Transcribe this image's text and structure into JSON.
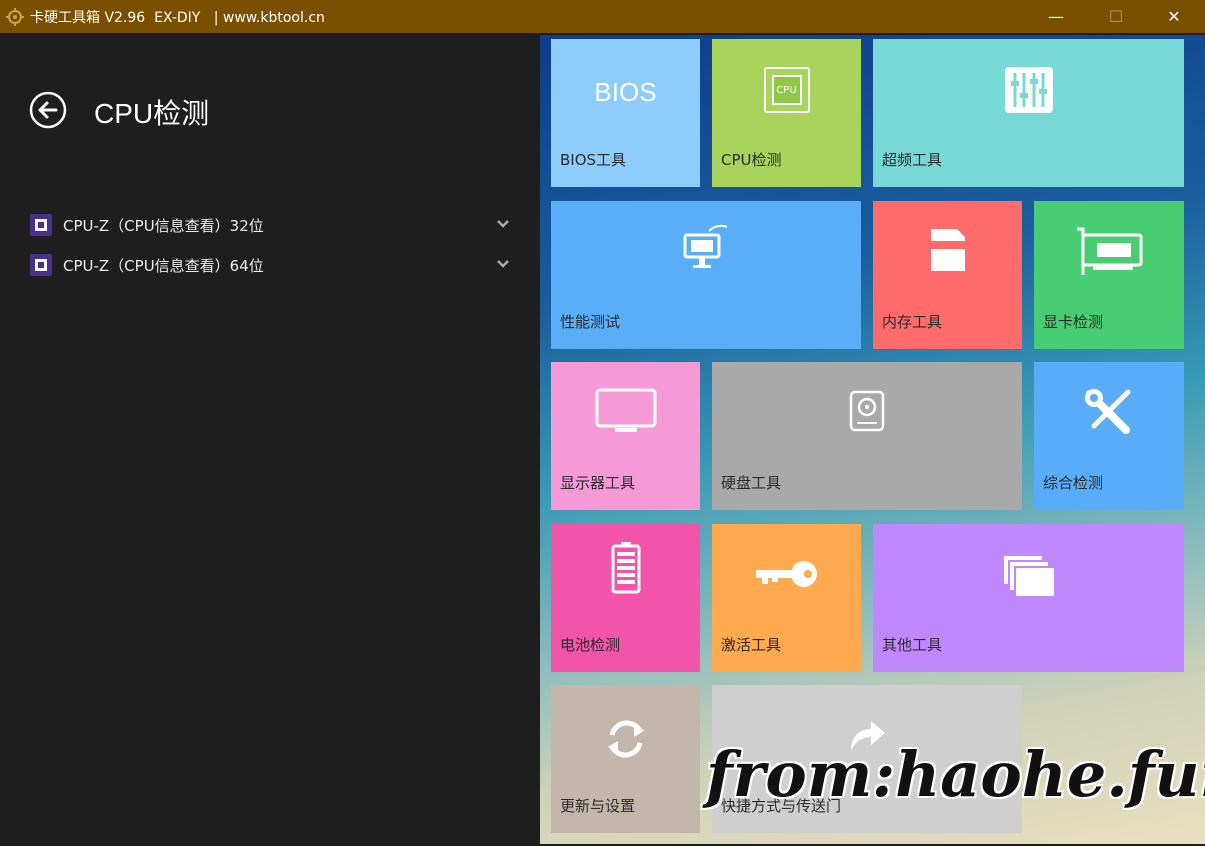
{
  "window": {
    "title": "卡硬工具箱 V2.96  EX-DIY   | www.kbtool.cn",
    "min_glyph": "—",
    "max_glyph": "☐",
    "close_glyph": "✕"
  },
  "page": {
    "title": "CPU检测",
    "items": [
      {
        "label": "CPU-Z（CPU信息查看）32位"
      },
      {
        "label": "CPU-Z（CPU信息查看）64位"
      }
    ]
  },
  "tiles": [
    {
      "id": "bios",
      "label": "BIOS工具",
      "icon_text": "BIOS",
      "color": "#8ecdfb"
    },
    {
      "id": "cpu",
      "label": "CPU检测",
      "icon_text": "CPU",
      "color": "#a8d45c"
    },
    {
      "id": "overclock",
      "label": "超频工具",
      "color": "#77d8d6"
    },
    {
      "id": "perf",
      "label": "性能测试",
      "color": "#5aaef7"
    },
    {
      "id": "memory",
      "label": "内存工具",
      "color": "#ff6b6b"
    },
    {
      "id": "gpu",
      "label": "显卡检测",
      "color": "#48cd72"
    },
    {
      "id": "monitor",
      "label": "显示器工具",
      "color": "#f59ad6"
    },
    {
      "id": "disk",
      "label": "硬盘工具",
      "color": "#a9a9a9"
    },
    {
      "id": "diag",
      "label": "综合检测",
      "color": "#58acf8"
    },
    {
      "id": "battery",
      "label": "电池检测",
      "color": "#f254a9"
    },
    {
      "id": "activate",
      "label": "激活工具",
      "color": "#ffaa4e"
    },
    {
      "id": "other",
      "label": "其他工具",
      "color": "#c088ff"
    },
    {
      "id": "update",
      "label": "更新与设置",
      "color": "#c3b6aa"
    },
    {
      "id": "shortcut",
      "label": "快捷方式与传送门",
      "color": "#cfcfcf"
    }
  ],
  "watermark": "from:haohe.fun"
}
